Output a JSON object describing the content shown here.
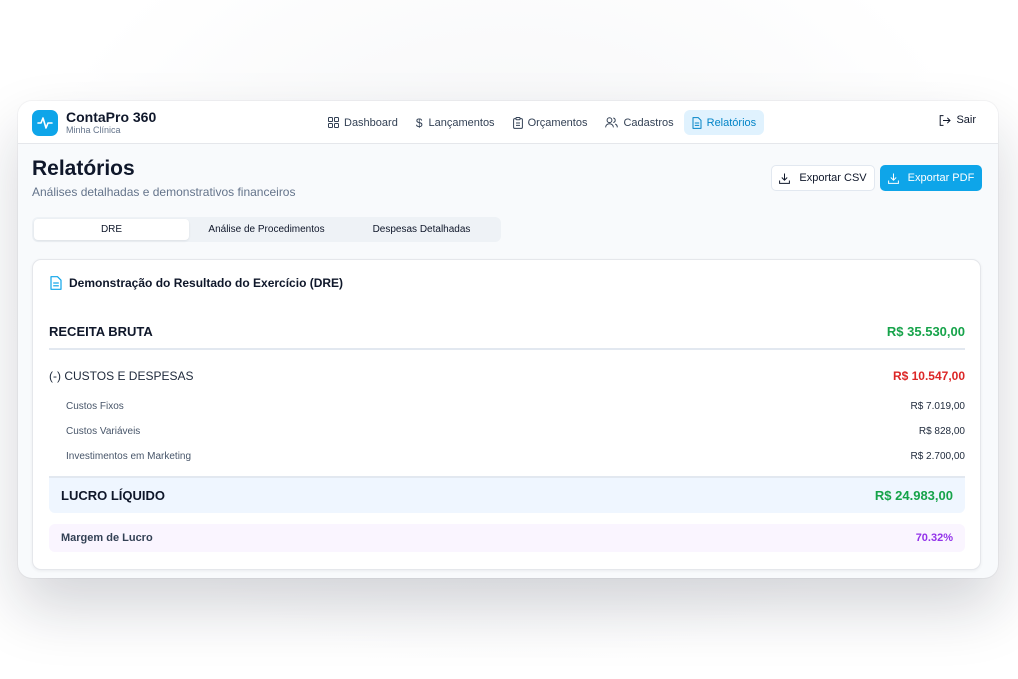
{
  "app": {
    "name": "ContaPro 360",
    "subtitle": "Minha Clínica"
  },
  "nav": {
    "items": [
      {
        "label": "Dashboard",
        "icon": "grid-icon"
      },
      {
        "label": "Lançamentos",
        "icon": "dollar-icon"
      },
      {
        "label": "Orçamentos",
        "icon": "clipboard-icon"
      },
      {
        "label": "Cadastros",
        "icon": "users-icon"
      },
      {
        "label": "Relatórios",
        "icon": "file-text-icon",
        "active": true
      }
    ],
    "logout_label": "Sair"
  },
  "page": {
    "title": "Relatórios",
    "subtitle": "Análises detalhadas e demonstrativos financeiros",
    "export_csv_label": "Exportar CSV",
    "export_pdf_label": "Exportar PDF"
  },
  "tabs": [
    {
      "label": "DRE",
      "active": true
    },
    {
      "label": "Análise de Procedimentos"
    },
    {
      "label": "Despesas Detalhadas"
    }
  ],
  "dre": {
    "title": "Demonstração do Resultado do Exercício (DRE)",
    "gross_revenue": {
      "label": "RECEITA BRUTA",
      "value": "R$ 35.530,00"
    },
    "costs": {
      "label": "(-) CUSTOS E DESPESAS",
      "value": "R$ 10.547,00"
    },
    "cost_items": [
      {
        "label": "Custos Fixos",
        "value": "R$ 7.019,00"
      },
      {
        "label": "Custos Variáveis",
        "value": "R$ 828,00"
      },
      {
        "label": "Investimentos em Marketing",
        "value": "R$ 2.700,00"
      }
    ],
    "net_profit": {
      "label": "LUCRO LÍQUIDO",
      "value": "R$ 24.983,00"
    },
    "profit_margin": {
      "label": "Margem de Lucro",
      "value": "70.32%"
    }
  },
  "colors": {
    "accent": "#0ea5e9",
    "positive": "#16a34a",
    "negative": "#dc2626",
    "margin": "#9333ea"
  }
}
